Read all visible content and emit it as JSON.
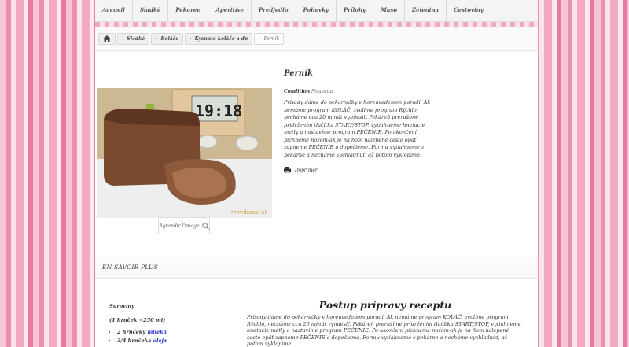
{
  "nav": {
    "items": [
      "Accueil",
      "Sladké",
      "Pekaren",
      "Aperitíve",
      "Predjedlo",
      "Polievky",
      "Prílohy",
      "Maso",
      "Zelenina",
      "Cestoviny"
    ]
  },
  "breadcrumb": {
    "home_icon": "home-icon",
    "items": [
      "Sladké",
      "Koláče",
      "Kysnuté koláče a dp"
    ],
    "current": "Perník"
  },
  "product": {
    "title": "Perník",
    "condition_label": "Condition",
    "condition_value": "Nouveau",
    "description": "Prísady dáme do pekárničky v horeuvedenom poradí. Ak nemáme program KOLÁČ, zvolíme program Rýchlo, necháme cca 20 minút vymiesiť. Pekáreň prerušíme pridržením tlačítka START/STOP, vytiahneme hnetacie metly a nastavíme program PEČENIE. Po ukončení pichneme nožom-ak je na ňom nalepené cesto opäť zapneme PEČENIE a dopečieme. Formu vytiahneme z pekárne a necháme vychladnúť, až potom vyklopíme.",
    "print_label": "Imprimer",
    "enlarge_label": "Agrandir l'image",
    "photo_clock": "19:18",
    "photo_watermark": "mimibazar.sk"
  },
  "more": {
    "label": "EN SAVOIR PLUS"
  },
  "recipe": {
    "ingredients_title": "Suroviny",
    "ingredients_note": "(1 hrnček ~250 ml)",
    "ingredients": [
      {
        "qty": "2 hrnčeky",
        "item": "mlieka"
      },
      {
        "qty": "3/4 hrnčeka",
        "item": "oleja"
      }
    ],
    "steps_title": "Postup prípravy receptu",
    "steps_text": "Prísady dáme do pekárničky v horeuvedenom poradí. Ak nemáme program KOLÁČ, zvolíme program Rýchlo, necháme cca 20 minút vymiesiť. Pekáreň prerušíme pridržením tlačítka START/STOP, vytiahneme hnetacie metly a nastavíme program PEČENIE. Po ukončení pichneme nožom-ak je na ňom nalepené cesto opäť zapneme PEČENIE a dopečieme. Formu vytiahneme z pekárne a necháme vychladnúť, až potom vyklopíme."
  },
  "colors": {
    "stripe_pink": "#e98fb0",
    "link_blue": "#2a32c6"
  }
}
